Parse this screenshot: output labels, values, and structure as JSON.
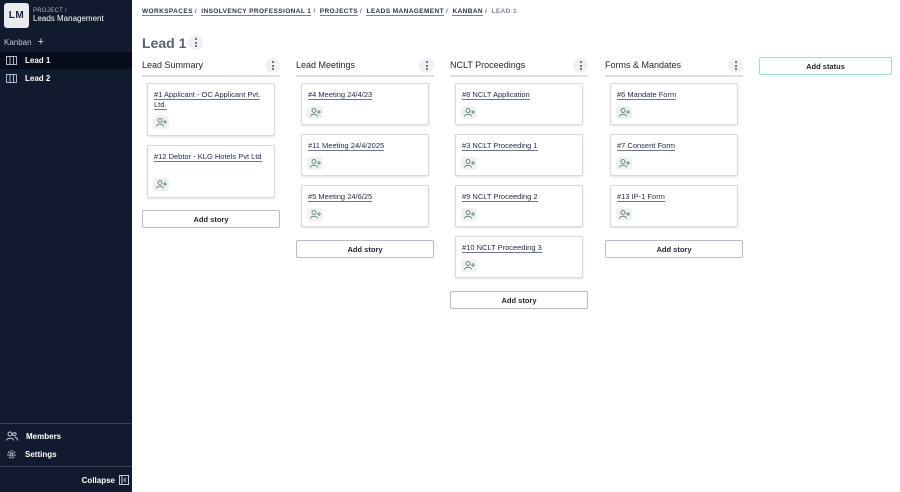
{
  "project": {
    "logo": "LM",
    "label": "PROJECT /",
    "name": "Leads Management"
  },
  "sidebar": {
    "section": "Kanban",
    "add_icon": "plus-icon",
    "items": [
      {
        "label": "Lead 1",
        "icon": "board-icon",
        "active": true
      },
      {
        "label": "Lead 2",
        "icon": "board-icon",
        "active": false
      }
    ],
    "members_label": "Members",
    "settings_label": "Settings",
    "collapse_label": "Collapse"
  },
  "breadcrumb": {
    "items": [
      "WORKSPACES",
      "INSOLVENCY PROFESSIONAL 1",
      "PROJECTS",
      "LEADS MANAGEMENT",
      "KANBAN"
    ],
    "current": "LEAD 1"
  },
  "page": {
    "title": "Lead 1"
  },
  "board": {
    "add_story_label": "Add story",
    "add_status_label": "Add status",
    "columns": [
      {
        "title": "Lead Summary",
        "cards": [
          {
            "title": "#1 Applicant - OC Applicant Pvt. Ltd."
          },
          {
            "title": "#12 Debtor - KLG Hotels Pvt Ltd"
          }
        ]
      },
      {
        "title": "Lead Meetings",
        "cards": [
          {
            "title": "#4 Meeting 24/4/23"
          },
          {
            "title": "#11 Meeting 24/4/2025"
          },
          {
            "title": "#5 Meeting 24/6/25"
          }
        ]
      },
      {
        "title": "NCLT Proceedings",
        "cards": [
          {
            "title": "#8 NCLT Application"
          },
          {
            "title": "#3 NCLT Proceeding 1"
          },
          {
            "title": "#9 NCLT Proceeding 2"
          },
          {
            "title": "#10 NCLT Proceeding 3"
          }
        ]
      },
      {
        "title": "Forms & Mandates",
        "cards": [
          {
            "title": "#6 Mandate Form"
          },
          {
            "title": "#7 Consent Form"
          },
          {
            "title": "#13 IP-1 Form"
          }
        ]
      }
    ]
  }
}
